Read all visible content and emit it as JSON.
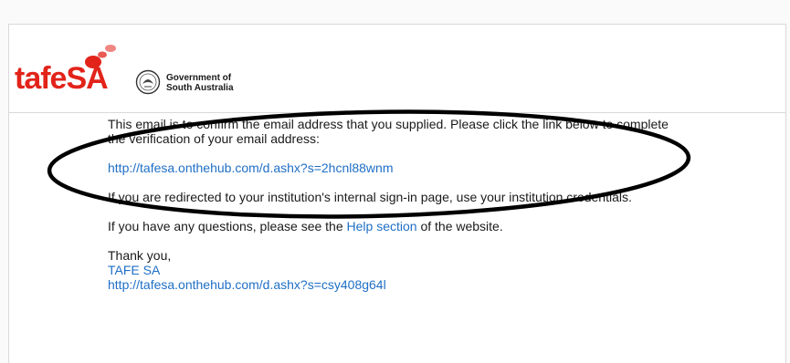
{
  "header": {
    "logo_text": "tafeSA",
    "logo_part1": "tafe",
    "logo_part2": "SA",
    "gov_line1": "Government of",
    "gov_line2": "South Australia"
  },
  "body": {
    "paragraph1": "This email is to confirm the email address that you supplied. Please click the link below to complete the verification of your email address:",
    "verification_link": "http://tafesa.onthehub.com/d.ashx?s=2hcnl88wnm",
    "paragraph2": "If you are redirected to your institution's internal sign-in page, use your institution credentials.",
    "paragraph3_prefix": "If you have any questions, please see the ",
    "help_link": "Help section",
    "paragraph3_suffix": " of the website.",
    "sign_off": "Thank you,",
    "signature_name": "TAFE SA",
    "signature_link": "http://tafesa.onthehub.com/d.ashx?s=csy408g64l"
  },
  "colors": {
    "brand_red": "#e2231a",
    "link_blue": "#1f6fc6",
    "annotation": "#000000"
  }
}
